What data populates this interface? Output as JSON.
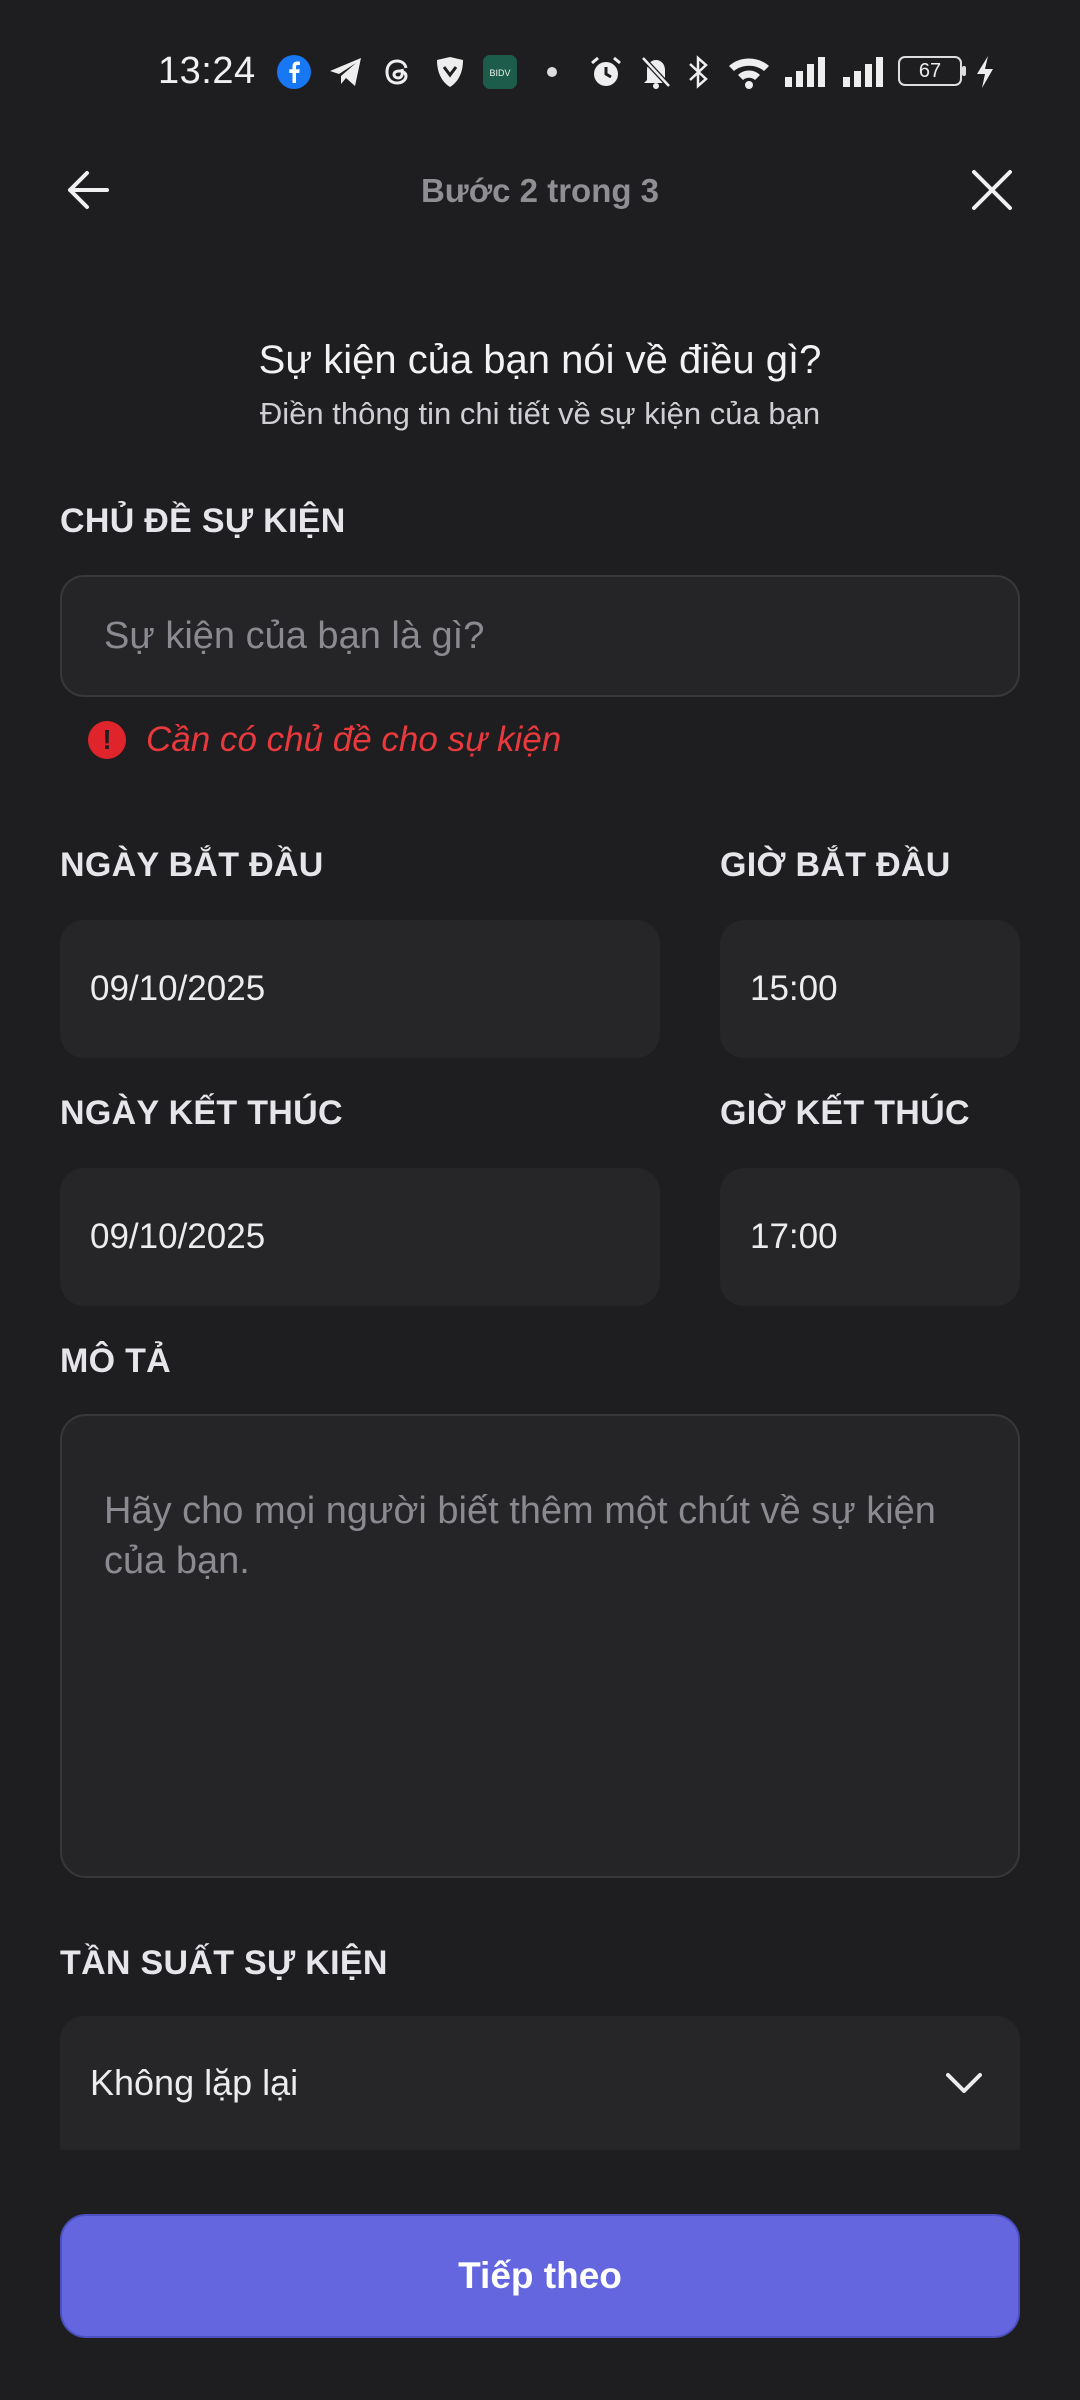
{
  "status_bar": {
    "time": "13:24",
    "battery": "67",
    "icons": [
      "facebook-icon",
      "telegram-icon",
      "threads-icon",
      "shield-app-icon",
      "bidv-app-icon",
      "dot-icon",
      "alarm-icon",
      "bell-off-icon",
      "bluetooth-icon",
      "wifi-icon",
      "signal-icon",
      "signal-icon",
      "battery-icon",
      "charging-icon"
    ],
    "colors": {
      "facebook": "#1877f2"
    }
  },
  "header": {
    "step_title": "Bước 2 trong 3",
    "back_icon": "arrow-left-icon",
    "close_icon": "close-icon"
  },
  "intro": {
    "title": "Sự kiện của bạn nói về điều gì?",
    "subtitle": "Điền thông tin chi tiết về sự kiện của bạn"
  },
  "form": {
    "topic": {
      "label": "CHỦ ĐỀ SỰ KIỆN",
      "placeholder": "Sự kiện của bạn là gì?",
      "value": "",
      "error": "Cần có chủ đề cho sự kiện"
    },
    "start_date": {
      "label": "NGÀY BẮT ĐẦU",
      "value": "09/10/2025"
    },
    "start_time": {
      "label": "GIỜ BẮT ĐẦU",
      "value": "15:00"
    },
    "end_date": {
      "label": "NGÀY KẾT THÚC",
      "value": "09/10/2025"
    },
    "end_time": {
      "label": "GIỜ KẾT THÚC",
      "value": "17:00"
    },
    "description": {
      "label": "MÔ TẢ",
      "placeholder": "Hãy cho mọi người biết thêm một chút về sự kiện của bạn.",
      "value": ""
    },
    "frequency": {
      "label": "TẦN SUẤT SỰ KIỆN",
      "value": "Không lặp lại"
    }
  },
  "footer": {
    "next_label": "Tiếp theo"
  },
  "colors": {
    "background": "#1e1e21",
    "accent": "#6366df",
    "error": "#e0242b",
    "field": "#262628"
  }
}
